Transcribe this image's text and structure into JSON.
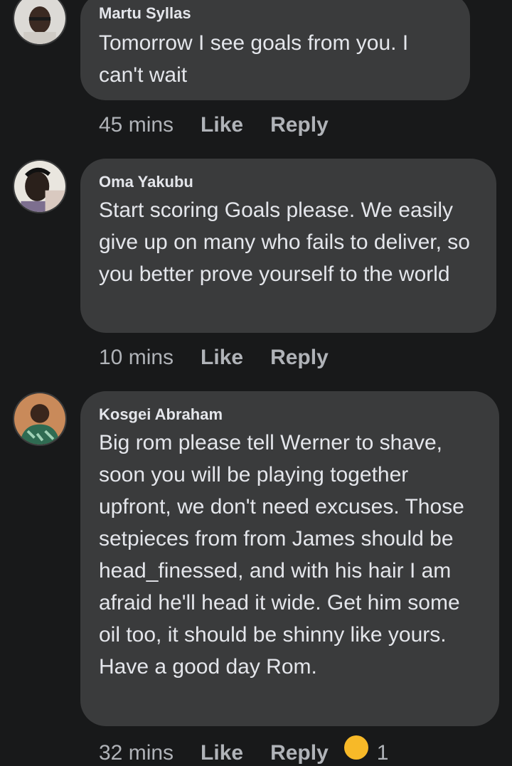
{
  "comments": [
    {
      "author": "Martu Syllas",
      "text": "Tomorrow I see goals from you. I can't wait",
      "time": "45 mins",
      "like_label": "Like",
      "reply_label": "Reply",
      "avatar_icon": "profile-photo"
    },
    {
      "author": "Oma Yakubu",
      "text": "Start scoring Goals please. We easily give up on many who fails to deliver, so you better prove yourself to the world",
      "time": "10 mins",
      "like_label": "Like",
      "reply_label": "Reply",
      "avatar_icon": "profile-photo"
    },
    {
      "author": "Kosgei Abraham",
      "text": "Big rom please tell Werner to shave, soon you will be playing together upfront, we don't need excuses. Those setpieces from from James should be head_finessed, and with his hair I am afraid he'll head it wide. Get him some oil too, it should be shinny like yours. Have a good day Rom.",
      "time": "32 mins",
      "like_label": "Like",
      "reply_label": "Reply",
      "reaction_icon": "laughing-emoji",
      "reaction_count": "1"
    }
  ],
  "colors": {
    "background": "#18191a",
    "bubble": "#3a3b3c",
    "text": "#e4e6eb",
    "secondary_text": "#b0b3b8",
    "reaction": "#f7b928"
  }
}
